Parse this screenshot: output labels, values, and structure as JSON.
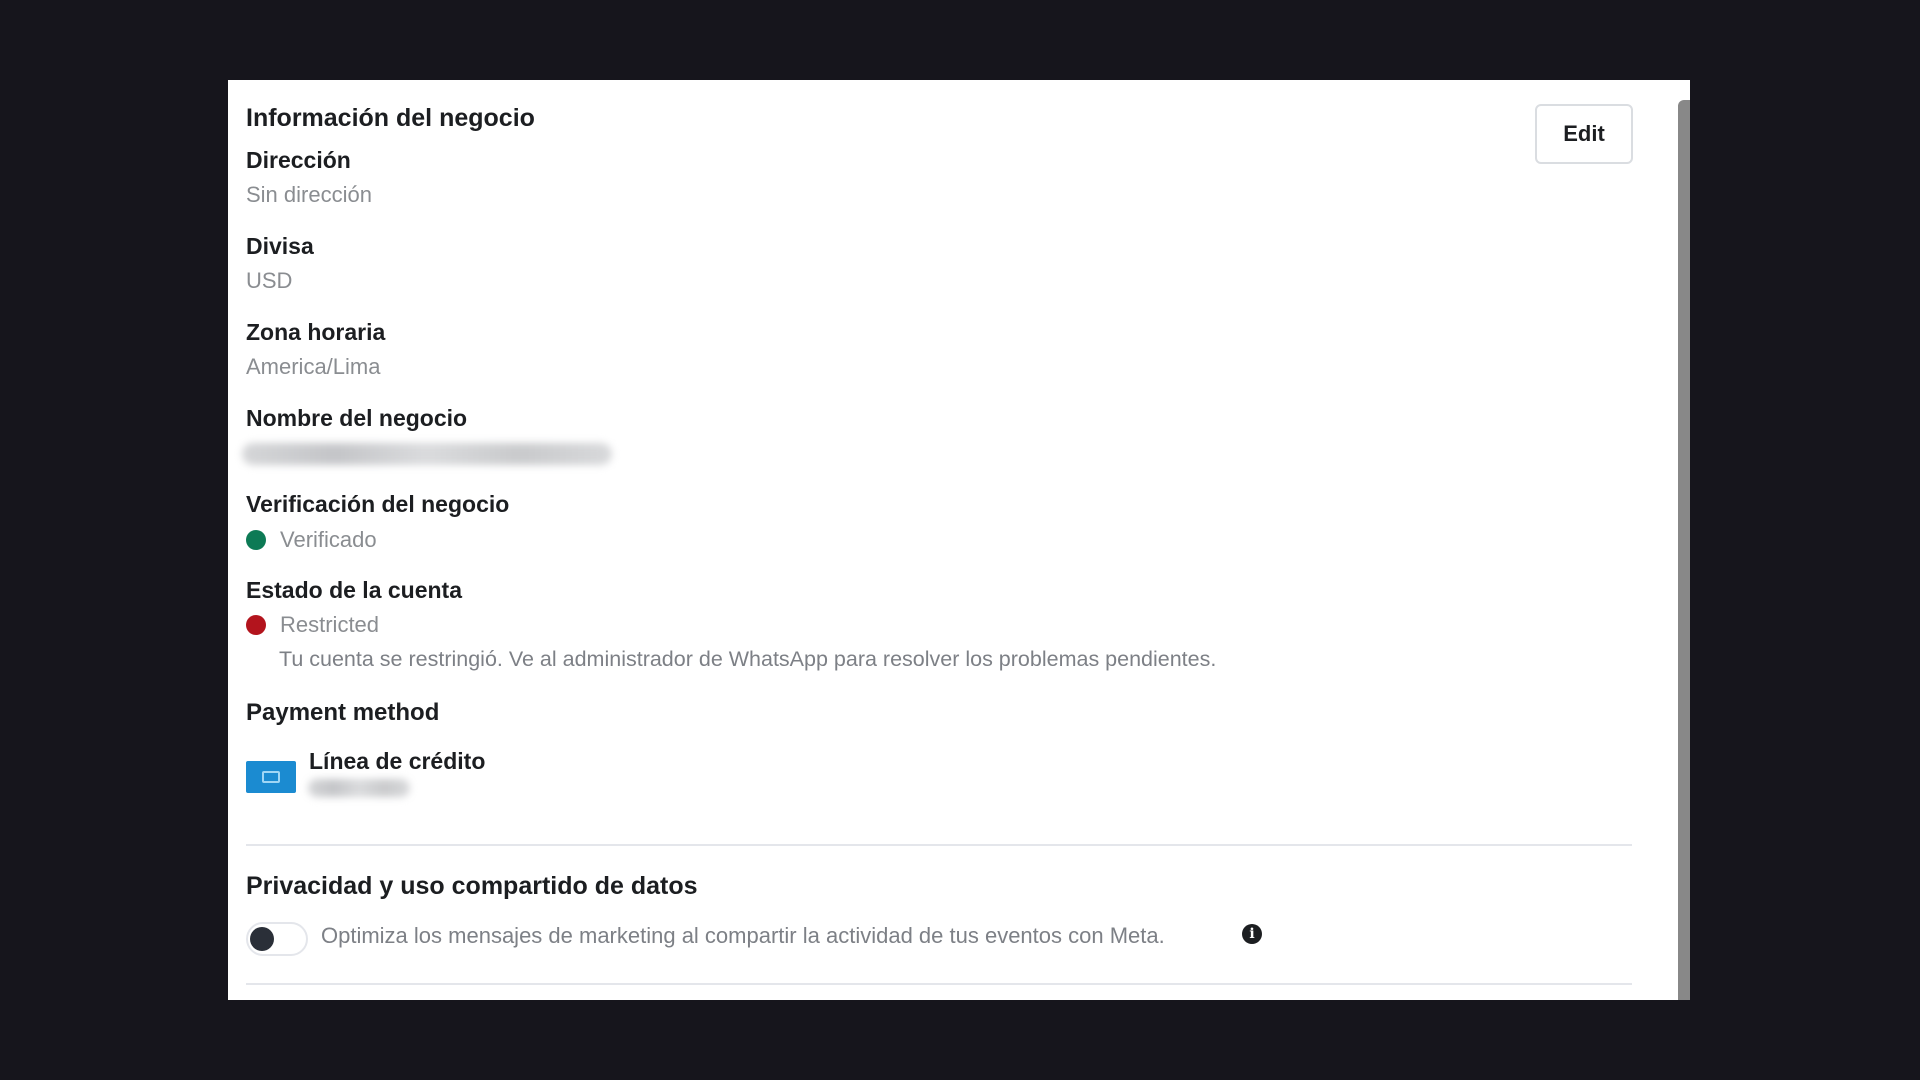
{
  "business_info": {
    "title": "Información del negocio",
    "edit_label": "Edit",
    "address": {
      "label": "Dirección",
      "value": "Sin dirección"
    },
    "currency": {
      "label": "Divisa",
      "value": "USD"
    },
    "timezone": {
      "label": "Zona horaria",
      "value": "America/Lima"
    },
    "business_name": {
      "label": "Nombre del negocio"
    },
    "verification": {
      "label": "Verificación del negocio",
      "status": "Verificado",
      "status_color": "#0d7a55"
    },
    "account_status": {
      "label": "Estado de la cuenta",
      "status": "Restricted",
      "status_color": "#b3141d",
      "note": "Tu cuenta se restringió. Ve al administrador de WhatsApp para resolver los problemas pendientes."
    },
    "payment": {
      "label": "Payment method",
      "method_name": "Línea de crédito",
      "icon": "credit-card-icon",
      "icon_color": "#1b8bd1"
    }
  },
  "privacy": {
    "title": "Privacidad y uso compartido de datos",
    "toggle_text": "Optimiza los mensajes de marketing al compartir la actividad de tus eventos con Meta.",
    "toggle_on": false,
    "info_icon": "info-icon"
  }
}
